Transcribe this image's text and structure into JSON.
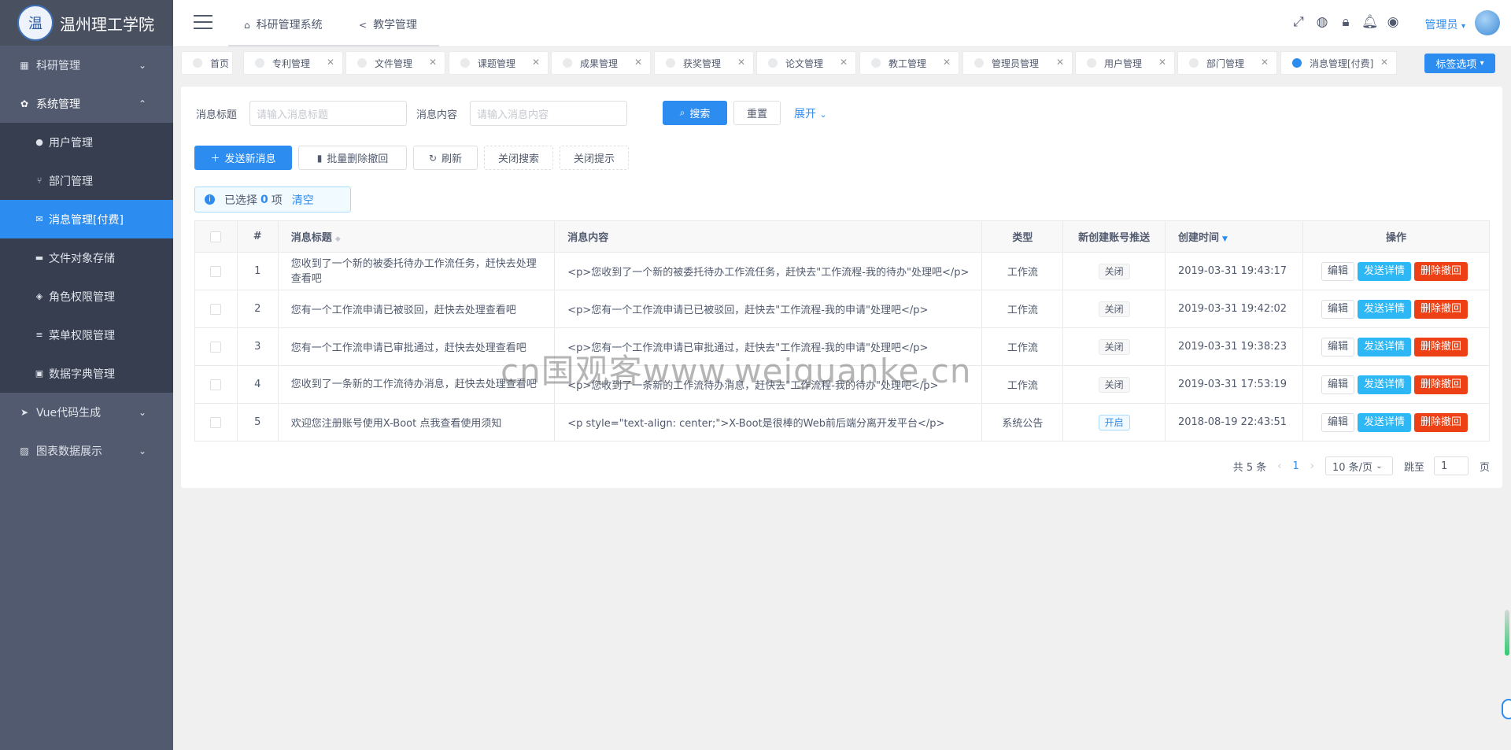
{
  "sidebar": {
    "logo_glyph": "温",
    "brand": "温州理工学院",
    "menus": [
      {
        "label": "科研管理",
        "icon": "grid-icon"
      },
      {
        "label": "系统管理",
        "icon": "gear-icon"
      },
      {
        "label": "Vue代码生成",
        "icon": "send-icon"
      },
      {
        "label": "图表数据展示",
        "icon": "chart-icon"
      }
    ],
    "sub_items": [
      {
        "label": "用户管理",
        "icon": "user-icon"
      },
      {
        "label": "部门管理",
        "icon": "branch-icon"
      },
      {
        "label": "消息管理[付费]",
        "icon": "mail-icon"
      },
      {
        "label": "文件对象存储",
        "icon": "folder-icon"
      },
      {
        "label": "角色权限管理",
        "icon": "roles-icon"
      },
      {
        "label": "菜单权限管理",
        "icon": "menu-icon"
      },
      {
        "label": "数据字典管理",
        "icon": "dictionary-icon"
      }
    ]
  },
  "header": {
    "nav": [
      {
        "label": "科研管理系统",
        "icon": "home-icon"
      },
      {
        "label": "教学管理",
        "icon": "share-icon"
      }
    ],
    "user": "管理员"
  },
  "tabs": {
    "items": [
      "首页",
      "专利管理",
      "文件管理",
      "课题管理",
      "成果管理",
      "获奖管理",
      "论文管理",
      "教工管理",
      "管理员管理",
      "用户管理",
      "部门管理",
      "消息管理[付费]"
    ],
    "options_label": "标签选项"
  },
  "search": {
    "title_label": "消息标题",
    "title_placeholder": "请输入消息标题",
    "content_label": "消息内容",
    "content_placeholder": "请输入消息内容",
    "search_btn": "搜索",
    "reset_btn": "重置",
    "expand": "展开"
  },
  "toolbar": {
    "send": "发送新消息",
    "batch_delete": "批量删除撤回",
    "refresh": "刷新",
    "close_search": "关闭搜索",
    "close_tip": "关闭提示"
  },
  "selection": {
    "prefix": "已选择",
    "count": "0",
    "suffix": "项",
    "clear": "清空"
  },
  "table": {
    "columns": [
      "#",
      "消息标题",
      "消息内容",
      "类型",
      "新创建账号推送",
      "创建时间",
      "操作"
    ],
    "rows": [
      {
        "no": "1",
        "title": "您收到了一个新的被委托待办工作流任务，赶快去处理查看吧",
        "content": "<p>您收到了一个新的被委托待办工作流任务，赶快去\"工作流程-我的待办\"处理吧</p>",
        "type": "工作流",
        "push": "关闭",
        "time": "2019-03-31 19:43:17"
      },
      {
        "no": "2",
        "title": "您有一个工作流申请已被驳回，赶快去处理查看吧",
        "content": "<p>您有一个工作流申请已已被驳回，赶快去\"工作流程-我的申请\"处理吧</p>",
        "type": "工作流",
        "push": "关闭",
        "time": "2019-03-31 19:42:02"
      },
      {
        "no": "3",
        "title": "您有一个工作流申请已审批通过，赶快去处理查看吧",
        "content": "<p>您有一个工作流申请已审批通过，赶快去\"工作流程-我的申请\"处理吧</p>",
        "type": "工作流",
        "push": "关闭",
        "time": "2019-03-31 19:38:23"
      },
      {
        "no": "4",
        "title": "您收到了一条新的工作流待办消息，赶快去处理查看吧",
        "content": "<p>您收到了一条新的工作流待办消息，赶快去\"工作流程-我的待办\"处理吧</p>",
        "type": "工作流",
        "push": "关闭",
        "time": "2019-03-31 17:53:19"
      },
      {
        "no": "5",
        "title": "欢迎您注册账号使用X-Boot 点我查看使用须知",
        "content": "<p style=\"text-align: center;\">X-Boot是很棒的Web前后端分离开发平台</p>",
        "type": "系统公告",
        "push": "开启",
        "time": "2018-08-19 22:43:51"
      }
    ],
    "actions": {
      "edit": "编辑",
      "detail": "发送详情",
      "delete": "删除撤回"
    }
  },
  "pager": {
    "total": "共 5 条",
    "current": "1",
    "size": "10 条/页",
    "jump_label": "跳至",
    "jump_value": "1",
    "page_unit": "页"
  },
  "watermark": "cn国观客www.weiguanke.cn"
}
